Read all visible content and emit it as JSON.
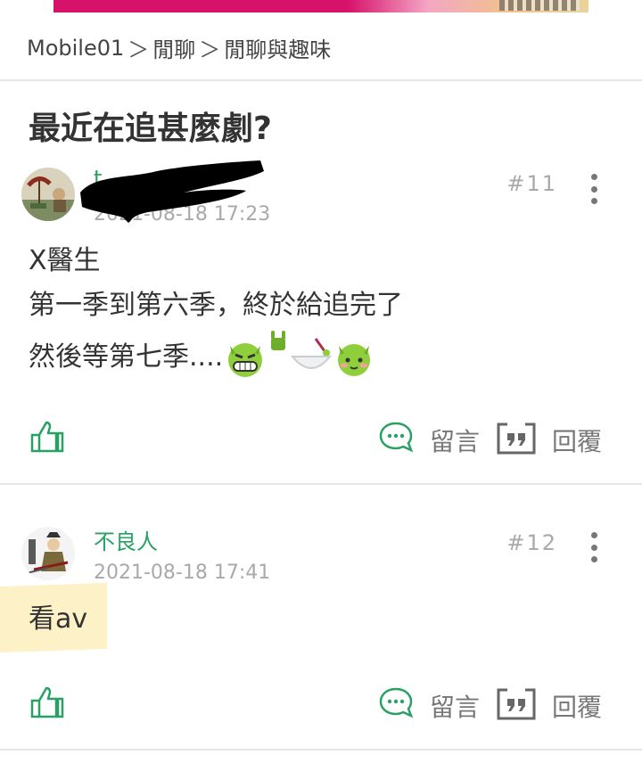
{
  "breadcrumb": {
    "site": "Mobile01",
    "separator": "＞",
    "category": "閒聊",
    "board": "閒聊與趣味"
  },
  "thread": {
    "title": "最近在追甚麼劇?"
  },
  "posts": [
    {
      "author": "t",
      "date": "2021-08-18 17:23",
      "floor": "#11",
      "content": [
        "X醫生",
        "第一季到第六季，終於給追完了",
        "然後等第七季...."
      ],
      "emoji_icons": [
        "grinning-devil-emoji",
        "rock-hand-emoji",
        "bowl-spoon-emoji",
        "green-devil-emoji"
      ],
      "comment_label": "留言",
      "reply_label": "回覆"
    },
    {
      "author": "不良人",
      "date": "2021-08-18 17:41",
      "floor": "#12",
      "content": [
        "看av"
      ],
      "comment_label": "留言",
      "reply_label": "回覆"
    }
  ],
  "colors": {
    "accent": "#2aa164",
    "muted": "#a9a9a9",
    "text": "#333333"
  }
}
